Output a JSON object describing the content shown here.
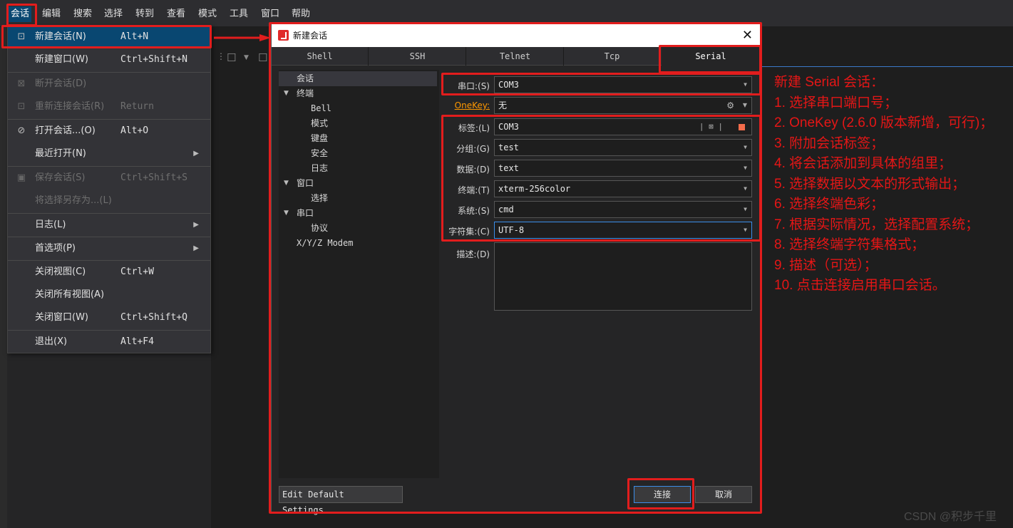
{
  "menubar": [
    "会话",
    "编辑",
    "搜索",
    "选择",
    "转到",
    "查看",
    "模式",
    "工具",
    "窗口",
    "帮助"
  ],
  "menu": {
    "items": [
      {
        "icon": "new-session-icon",
        "label": "新建会话(N)",
        "shortcut": "Alt+N",
        "highlighted": true
      },
      {
        "label": "新建窗口(W)",
        "shortcut": "Ctrl+Shift+N"
      },
      {
        "icon": "disconnect-icon",
        "label": "断开会话(D)",
        "disabled": true
      },
      {
        "icon": "reconnect-icon",
        "label": "重新连接会话(R)",
        "shortcut": "Return",
        "disabled": true
      },
      {
        "icon": "open-session-icon",
        "label": "打开会话...(O)",
        "shortcut": "Alt+O"
      },
      {
        "label": "最近打开(N)",
        "submenu": true
      },
      {
        "icon": "save-icon",
        "label": "保存会话(S)",
        "shortcut": "Ctrl+Shift+S",
        "disabled": true
      },
      {
        "label": "将选择另存为...(L)",
        "disabled": true
      },
      {
        "label": "日志(L)",
        "submenu": true
      },
      {
        "label": "首选项(P)",
        "submenu": true
      },
      {
        "label": "关闭视图(C)",
        "shortcut": "Ctrl+W"
      },
      {
        "label": "关闭所有视图(A)"
      },
      {
        "label": "关闭窗口(W)",
        "shortcut": "Ctrl+Shift+Q"
      },
      {
        "label": "退出(X)",
        "shortcut": "Alt+F4"
      }
    ]
  },
  "dialog": {
    "title": "新建会话",
    "tabs": [
      "Shell",
      "SSH",
      "Telnet",
      "Tcp",
      "Serial"
    ],
    "active_tab": "Serial",
    "tree": [
      "会话",
      "终端",
      "Bell",
      "模式",
      "键盘",
      "安全",
      "日志",
      "窗口",
      "选择",
      "串口",
      "协议",
      "X/Y/Z Modem"
    ],
    "form": {
      "port_label": "串口:(S)",
      "port_value": "COM3",
      "onekey_label": "OneKey:",
      "onekey_value": "无",
      "tag_label": "标签:(L)",
      "tag_value": "COM3",
      "group_label": "分组:(G)",
      "group_value": "test",
      "data_label": "数据:(D)",
      "data_value": "text",
      "terminal_label": "终端:(T)",
      "terminal_value": "xterm-256color",
      "system_label": "系统:(S)",
      "system_value": "cmd",
      "charset_label": "字符集:(C)",
      "charset_value": "UTF-8",
      "desc_label": "描述:(D)"
    },
    "default_settings_button": "Edit Default Settings...",
    "connect_button": "连接",
    "cancel_button": "取消"
  },
  "notes": [
    "新建 Serial 会话：",
    "1. 选择串口端口号；",
    "2. OneKey (2.6.0 版本新增，可行)；",
    "3. 附加会话标签；",
    "4. 将会话添加到具体的组里；",
    "5. 选择数据以文本的形式输出；",
    "6. 选择终端色彩；",
    "7. 根据实际情况，选择配置系统；",
    "8. 选择终端字符集格式；",
    "9. 描述（可选）；",
    "10. 点击连接启用串口会话。"
  ],
  "watermark": "CSDN @积步千里",
  "colors": {
    "annotation_red": "#e21d1d",
    "highlight_blue": "#094771",
    "onekey_orange": "#ff9800",
    "focus_blue": "#3b8eea"
  }
}
